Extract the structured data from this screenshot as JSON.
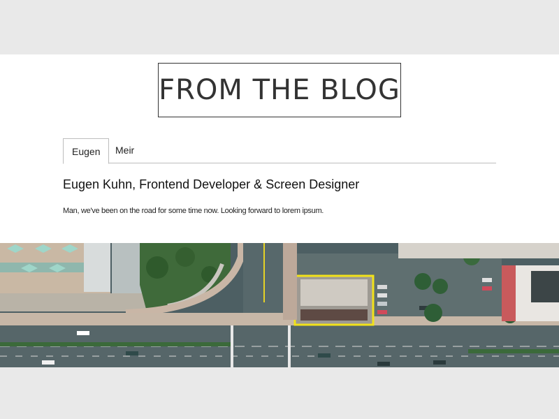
{
  "header": {
    "title": "FROM THE BLOG"
  },
  "tabs": [
    {
      "label": "Eugen",
      "active": true
    },
    {
      "label": "Meir",
      "active": false
    }
  ],
  "article": {
    "heading": "Eugen Kuhn, Frontend Developer & Screen Designer",
    "body": "Man, we've been on the road for some time now. Looking forward to lorem ipsum."
  },
  "colors": {
    "page_bg": "#e9e9e9",
    "card_bg": "#ffffff",
    "highlight": "#f2e21a"
  }
}
